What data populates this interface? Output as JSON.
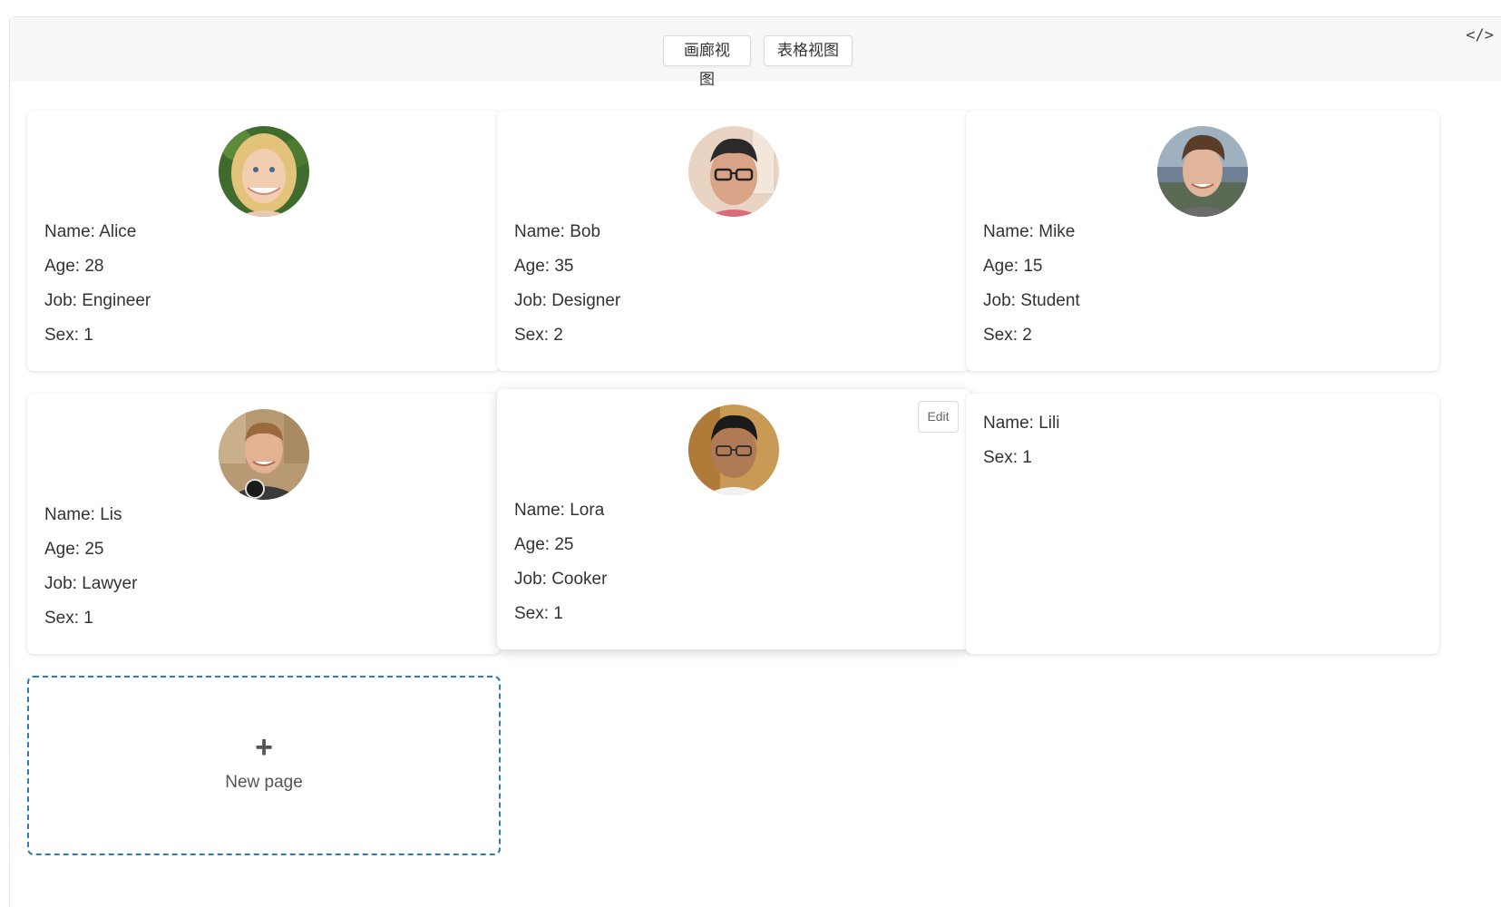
{
  "toolbar": {
    "gallery_label": "画廊视图",
    "table_label": "表格视图",
    "code_toggle": "</>"
  },
  "cards": [
    {
      "name": "Name: Alice",
      "age": "Age: 28",
      "job": "Job: Engineer",
      "sex": "Sex: 1",
      "avatar": "avatar-blonde-woman"
    },
    {
      "name": "Name: Bob",
      "age": "Age: 35",
      "job": "Job: Designer",
      "sex": "Sex: 2",
      "avatar": "avatar-man-glasses"
    },
    {
      "name": "Name: Mike",
      "age": "Age: 15",
      "job": "Job: Student",
      "sex": "Sex: 2",
      "avatar": "avatar-young-man"
    },
    {
      "name": "Name: Lis",
      "age": "Age: 25",
      "job": "Job: Lawyer",
      "sex": "Sex: 1",
      "avatar": "avatar-smiling-man"
    },
    {
      "name": "Name: Lora",
      "age": "Age: 25",
      "job": "Job: Cooker",
      "sex": "Sex: 1",
      "avatar": "avatar-man-glasses-dark",
      "edit_label": "Edit"
    },
    {
      "name": "Name: Lili",
      "sex": "Sex: 1"
    }
  ],
  "new_page": {
    "plus": "+",
    "label": "New page"
  }
}
